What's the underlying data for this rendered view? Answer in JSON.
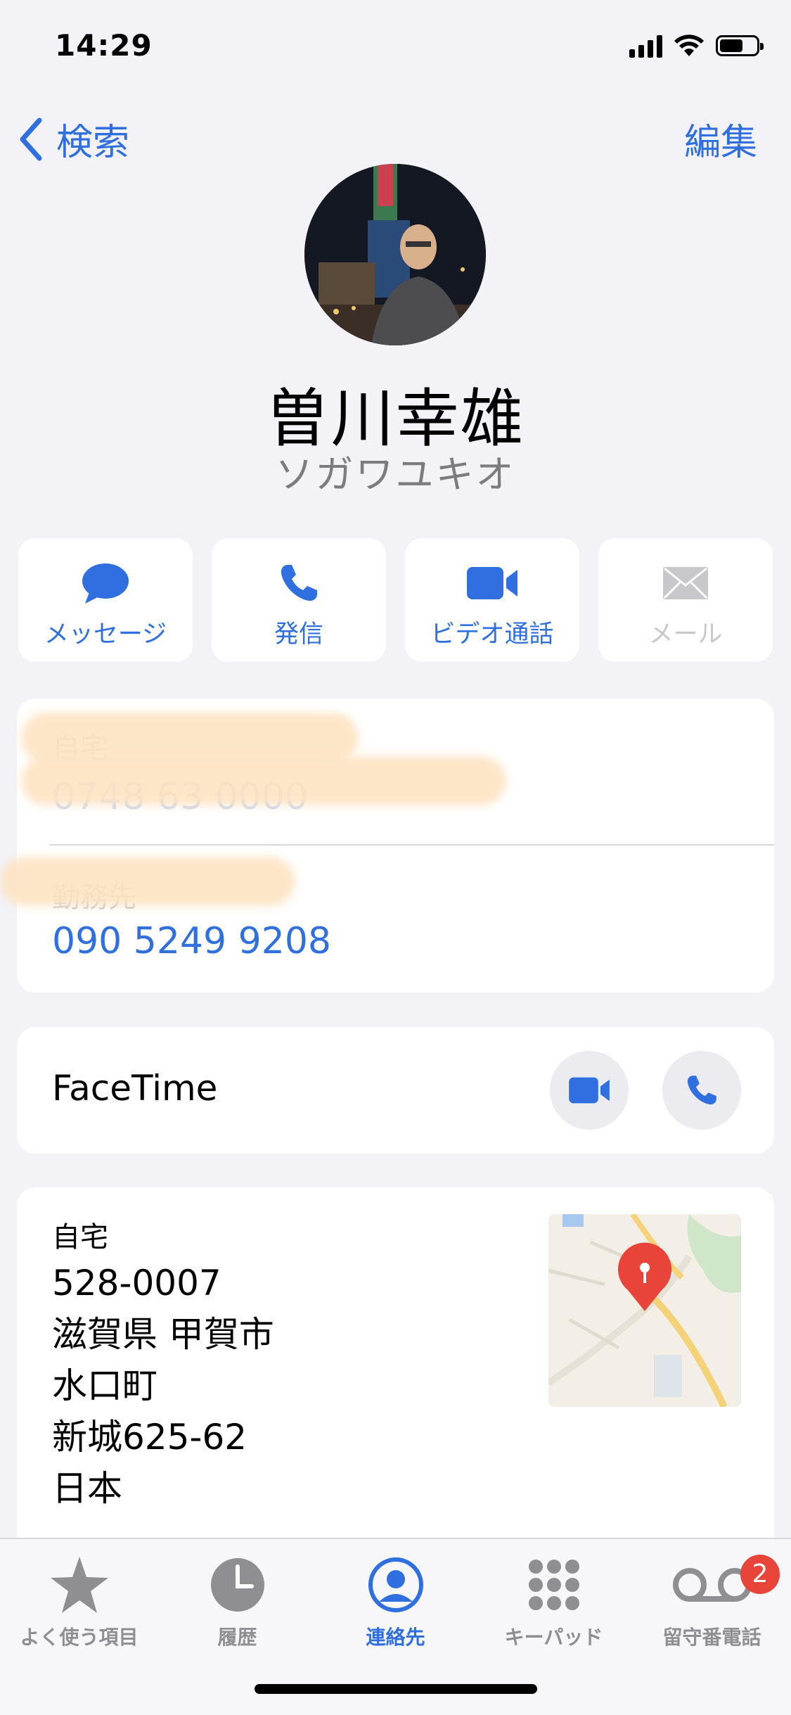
{
  "status": {
    "time": "14:29"
  },
  "nav": {
    "back_label": "検索",
    "edit_label": "編集"
  },
  "contact": {
    "name": "曽川幸雄",
    "phonetic": "ソガワユキオ"
  },
  "actions": [
    {
      "label": "メッセージ",
      "icon": "message-bubble-icon",
      "enabled": true
    },
    {
      "label": "発信",
      "icon": "phone-icon",
      "enabled": true
    },
    {
      "label": "ビデオ通話",
      "icon": "video-camera-icon",
      "enabled": true
    },
    {
      "label": "メール",
      "icon": "envelope-icon",
      "enabled": false
    }
  ],
  "phones": [
    {
      "label": "自宅",
      "number": "0748 63 0000",
      "redacted": true
    },
    {
      "label": "勤務先",
      "number": "090 5249 9208",
      "redacted": false
    }
  ],
  "facetime": {
    "label": "FaceTime"
  },
  "address": {
    "label": "自宅",
    "lines": [
      "528-0007",
      "滋賀県 甲賀市",
      "水口町",
      "新城625-62",
      "日本"
    ]
  },
  "tabs": [
    {
      "label": "よく使う項目",
      "icon": "star-icon",
      "active": false
    },
    {
      "label": "履歴",
      "icon": "clock-icon",
      "active": false
    },
    {
      "label": "連絡先",
      "icon": "person-circle-icon",
      "active": true
    },
    {
      "label": "キーパッド",
      "icon": "keypad-icon",
      "active": false
    },
    {
      "label": "留守番電話",
      "icon": "voicemail-icon",
      "active": false,
      "badge": "2"
    }
  ],
  "colors": {
    "accent": "#2f6fe0",
    "background": "#f2f2f7",
    "badge": "#e8443a",
    "disabled": "#c7c7cc"
  }
}
